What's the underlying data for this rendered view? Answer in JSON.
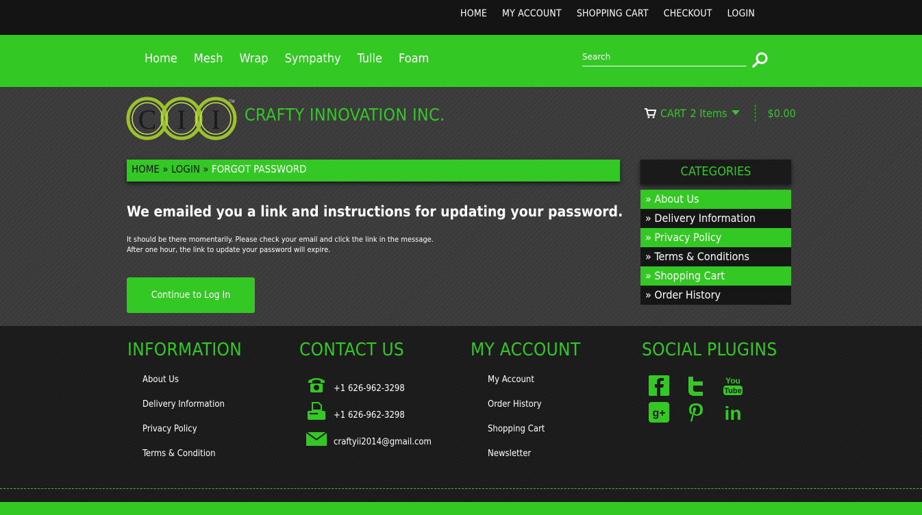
{
  "top_links": [
    "HOME",
    "MY ACCOUNT",
    "SHOPPING CART",
    "CHECKOUT",
    "LOGIN"
  ],
  "main_nav": [
    "Home",
    "Mesh",
    "Wrap",
    "Sympathy",
    "Tulle",
    "Foam"
  ],
  "search": {
    "placeholder": "Search"
  },
  "logo": {
    "letters": [
      "C",
      "I",
      "I"
    ],
    "tm": "TM"
  },
  "brand": "CRAFTY INNOVATION INC.",
  "cart": {
    "label": "CART",
    "items": "2 Items",
    "total": "$0.00"
  },
  "breadcrumb": {
    "home": "HOME",
    "login": "LOGIN",
    "current": "FORGOT PASSWORD",
    "sep": "»"
  },
  "headline": "We emailed you a link and instructions for updating your password.",
  "message": {
    "line1": "It should be there momentarily. Please check your email and click the link in the message.",
    "line2": "After one hour, the link to update your password will expire."
  },
  "continue_label": "Continue to Log In",
  "categories": {
    "title": "CATEGORIES",
    "items": [
      "» About Us",
      "» Delivery Information",
      "» Privacy Policy",
      "» Terms & Conditions",
      "» Shopping Cart",
      "» Order History"
    ]
  },
  "footer": {
    "information": {
      "title": "INFORMATION",
      "links": [
        "About Us",
        "Delivery Information",
        "Privacy Policy",
        "Terms & Condition"
      ]
    },
    "contact": {
      "title": "CONTACT US",
      "phone": "+1 626-962-3298",
      "fax": "+1 626-962-3298",
      "email": "craftyii2014@gmail.com"
    },
    "my_account": {
      "title": "MY ACCOUNT",
      "links": [
        "My Account",
        "Order History",
        "Shopping Cart",
        "Newsletter"
      ]
    },
    "social": {
      "title": "SOCIAL PLUGINS",
      "icons": [
        "facebook-icon",
        "twitter-icon",
        "youtube-icon",
        "google-plus-icon",
        "pinterest-icon",
        "linkedin-icon"
      ],
      "youtube_text": [
        "You",
        "Tube"
      ],
      "gplus_text": "g+",
      "linkedin_text": "in"
    }
  },
  "colors": {
    "accent": "#33c823",
    "dark": "#141414",
    "gray": "#3a3a3a"
  }
}
